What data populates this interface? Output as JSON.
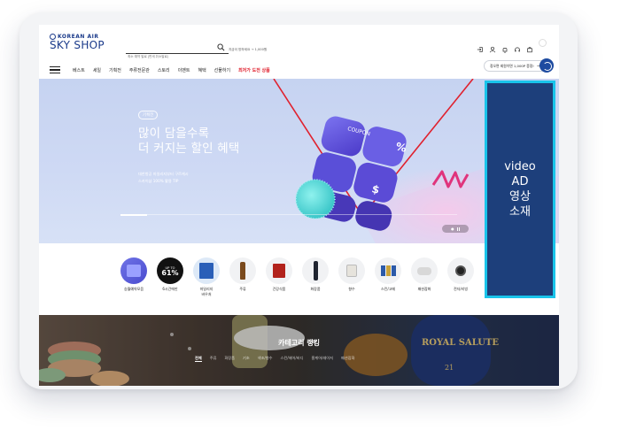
{
  "header": {
    "logo_brand": "KOREAN AIR",
    "logo_main": "SKY SHOP",
    "search_placeholder": "최소 예약 발료 (면세 취소발료)",
    "search_hint": "지금이 방하세요 → 1,000원"
  },
  "nav": {
    "items": [
      "베스트",
      "세일",
      "기획전",
      "주류전문관",
      "스토리",
      "이벤트",
      "혜택",
      "선물하기"
    ],
    "highlight": "최저가 도전 상품",
    "promo": "정오면 회원이면 1,000P 증정!"
  },
  "hero": {
    "tag": "기획전",
    "title_lines": [
      "많이 담을수록",
      "더 커지는 할인 혜택"
    ],
    "sub_lines": [
      "대한항공 마일리지부터 구르캐시",
      "스카이샵 100% 활용 TIP"
    ],
    "progress": 0.08,
    "cube_labels": [
      "COUPON",
      "%",
      "$"
    ]
  },
  "video_ad": {
    "lines": [
      "video",
      "AD",
      "영상",
      "소재"
    ]
  },
  "categories": [
    {
      "label": "승월예약모음",
      "icon": "gift-box-icon"
    },
    {
      "label": "6시간에만",
      "icon": "up-to-61-icon",
      "badge_top": "UP TO",
      "badge_main": "61%"
    },
    {
      "label": "마일리지\n바우처",
      "icon": "voucher-icon"
    },
    {
      "label": "주류",
      "icon": "liquor-icon"
    },
    {
      "label": "건강식품",
      "icon": "health-icon"
    },
    {
      "label": "화장품",
      "icon": "cosmetics-icon"
    },
    {
      "label": "향수",
      "icon": "perfume-icon"
    },
    {
      "label": "스킨/고메",
      "icon": "skincare-icon"
    },
    {
      "label": "패션잡화",
      "icon": "fashion-icon"
    },
    {
      "label": "전자/리빙",
      "icon": "watch-icon"
    }
  ],
  "ranking": {
    "title": "카테고리 랭킹",
    "tabs": [
      "전체",
      "주류",
      "화장품",
      "기초",
      "색조/향수",
      "스킨/헤어/바디",
      "홈케어/레이저",
      "패션잡화"
    ]
  },
  "colors": {
    "accent": "#1a3a8a",
    "ad_bg": "#1d3f7b",
    "ad_border": "#19c4ea",
    "highlight_red": "#e0212e"
  }
}
